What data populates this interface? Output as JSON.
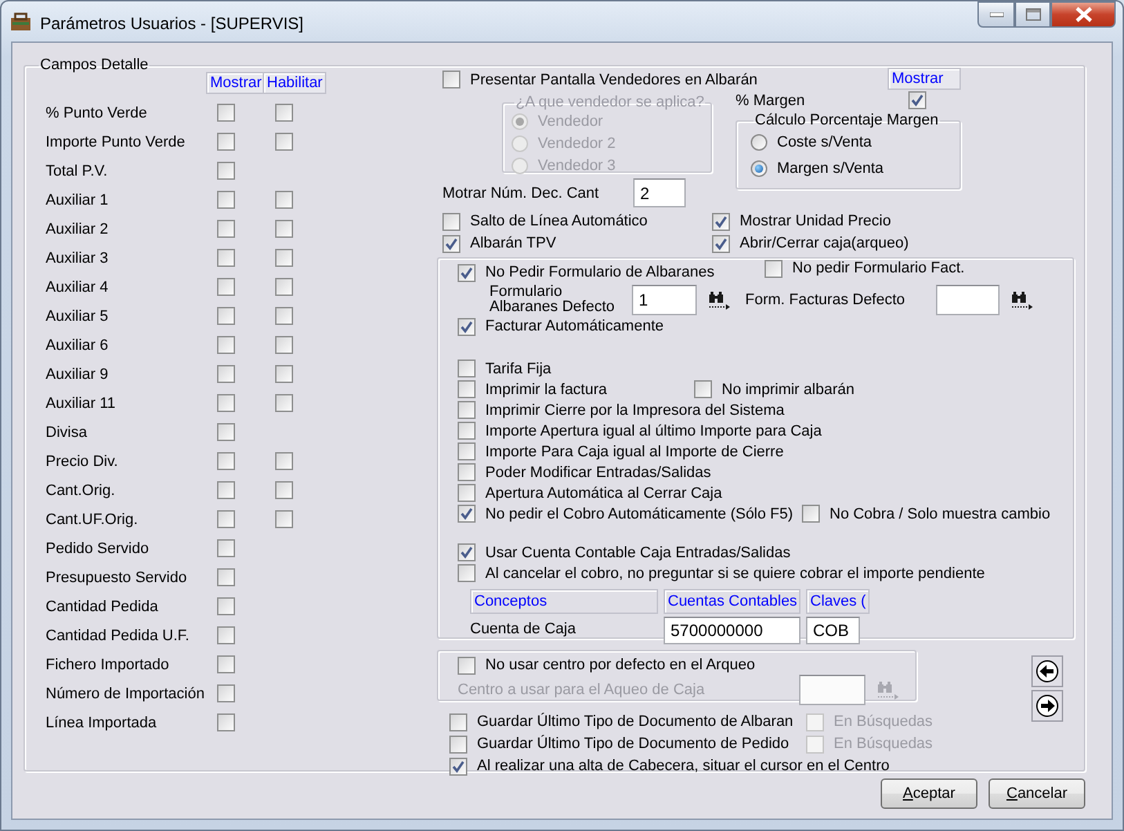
{
  "window": {
    "title": "Parámetros Usuarios - [SUPERVIS]"
  },
  "detail_group": {
    "title": "Campos Detalle",
    "columns": [
      "Mostrar",
      "Habilitar"
    ],
    "fields": [
      {
        "label": "% Punto Verde",
        "kind": "both",
        "show": false,
        "enable": false
      },
      {
        "label": "Importe Punto Verde",
        "kind": "both",
        "show": false,
        "enable": false
      },
      {
        "label": "Total P.V.",
        "kind": "show_only",
        "show": false
      },
      {
        "label": "Auxiliar 1",
        "kind": "both",
        "show": false,
        "enable": false
      },
      {
        "label": "Auxiliar 2",
        "kind": "both",
        "show": false,
        "enable": false
      },
      {
        "label": "Auxiliar 3",
        "kind": "both",
        "show": false,
        "enable": false
      },
      {
        "label": "Auxiliar 4",
        "kind": "both",
        "show": false,
        "enable": false
      },
      {
        "label": "Auxiliar 5",
        "kind": "both",
        "show": false,
        "enable": false
      },
      {
        "label": "Auxiliar 6",
        "kind": "both",
        "show": false,
        "enable": false
      },
      {
        "label": "Auxiliar 9",
        "kind": "both",
        "show": false,
        "enable": false
      },
      {
        "label": "Auxiliar 11",
        "kind": "both",
        "show": false,
        "enable": false
      },
      {
        "label": "Divisa",
        "kind": "show_only",
        "show": false
      },
      {
        "label": "Precio Div.",
        "kind": "both",
        "show": false,
        "enable": false
      },
      {
        "label": "Cant.Orig.",
        "kind": "both",
        "show": false,
        "enable": false
      },
      {
        "label": "Cant.UF.Orig.",
        "kind": "both",
        "show": false,
        "enable": false
      },
      {
        "label": "Pedido Servido",
        "kind": "show_only",
        "show": false
      },
      {
        "label": "Presupuesto Servido",
        "kind": "show_only",
        "show": false
      },
      {
        "label": "Cantidad Pedida",
        "kind": "show_only",
        "show": false
      },
      {
        "label": "Cantidad Pedida U.F.",
        "kind": "show_only",
        "show": false
      },
      {
        "label": "Fichero Importado",
        "kind": "show_only",
        "show": false
      },
      {
        "label": "Número de Importación",
        "kind": "show_only",
        "show": false
      },
      {
        "label": "Línea Importada",
        "kind": "show_only",
        "show": false
      }
    ]
  },
  "vendors": {
    "checkbox": {
      "label": "Presentar Pantalla Vendedores en Albarán",
      "checked": false
    },
    "group_title": "¿A que vendedor se aplica?",
    "disabled": true,
    "options": [
      {
        "label": "Vendedor",
        "selected": true
      },
      {
        "label": "Vendedor 2",
        "selected": false
      },
      {
        "label": "Vendedor 3",
        "selected": false
      }
    ]
  },
  "decimals": {
    "label": "Motrar Núm. Dec. Cant",
    "value": "2"
  },
  "margin": {
    "column": "Mostrar",
    "label": "% Margen",
    "checked": true,
    "group_title": "Cálculo Porcentaje Margen",
    "options": [
      {
        "label": "Coste s/Venta",
        "selected": false
      },
      {
        "label": "Margen s/Venta",
        "selected": true
      }
    ]
  },
  "general_options": [
    {
      "label": "Salto de Línea Automático",
      "checked": false
    },
    {
      "label": "Mostrar Unidad Precio",
      "checked": true
    },
    {
      "label": "Albarán TPV",
      "checked": true
    },
    {
      "label": "Abrir/Cerrar caja(arqueo)",
      "checked": true
    }
  ],
  "invoice_group": {
    "no_delivery_form": {
      "label": "No Pedir Formulario de Albaranes",
      "checked": true
    },
    "no_invoice_form": {
      "label": "No pedir Formulario Fact.",
      "checked": false
    },
    "default_forms": [
      {
        "label": "Formulario Albaranes Defecto",
        "value": "1"
      },
      {
        "label": "Form. Facturas Defecto"
      }
    ],
    "auto_invoice": {
      "label": "Facturar Automáticamente",
      "checked": true
    },
    "cash_options": [
      {
        "label": "Tarifa Fija",
        "checked": false
      },
      {
        "label": "Imprimir la factura",
        "checked": false,
        "side": {
          "label": "No imprimir albarán",
          "checked": false
        }
      },
      {
        "label": "Imprimir Cierre por la Impresora del Sistema",
        "checked": false
      },
      {
        "label": "Importe Apertura igual al último Importe para Caja",
        "checked": false
      },
      {
        "label": "Importe Para Caja igual al Importe de Cierre",
        "checked": false
      },
      {
        "label": "Poder Modificar Entradas/Salidas",
        "checked": false
      },
      {
        "label": "Apertura Automática al Cerrar Caja",
        "checked": false
      },
      {
        "label": "No pedir el Cobro Automáticamente (Sólo F5)",
        "checked": true,
        "side": {
          "label": "No Cobra / Solo muestra cambio",
          "checked": false
        }
      }
    ],
    "account_options": [
      {
        "label": "Usar Cuenta Contable Caja Entradas/Salidas",
        "checked": true
      },
      {
        "label": "Al cancelar el cobro, no preguntar si se quiere cobrar el importe pendiente",
        "checked": false
      }
    ],
    "accounts_table": {
      "columns": [
        "Conceptos",
        "Cuentas Contables",
        "Claves ("
      ],
      "rows": [
        {
          "concept": "Cuenta de Caja",
          "account": "5700000000",
          "key": "COB"
        }
      ]
    }
  },
  "center_group": {
    "checkbox": {
      "label": "No usar centro por defecto en el Arqueo",
      "checked": false
    },
    "field_label": "Centro a usar para el Aqueo de Caja",
    "disabled": true
  },
  "document_options": [
    {
      "label": "Guardar Último Tipo de Documento de Albaran",
      "checked": false,
      "search": {
        "label": "En Búsquedas",
        "checked": false,
        "disabled": true
      }
    },
    {
      "label": "Guardar Último Tipo de Documento de Pedido",
      "checked": false,
      "search": {
        "label": "En Búsquedas",
        "checked": false,
        "disabled": true
      }
    },
    {
      "label": "Al realizar una alta de Cabecera, situar el cursor en el Centro",
      "checked": true
    }
  ],
  "buttons": [
    {
      "label": "Aceptar"
    },
    {
      "label": "Cancelar"
    }
  ]
}
